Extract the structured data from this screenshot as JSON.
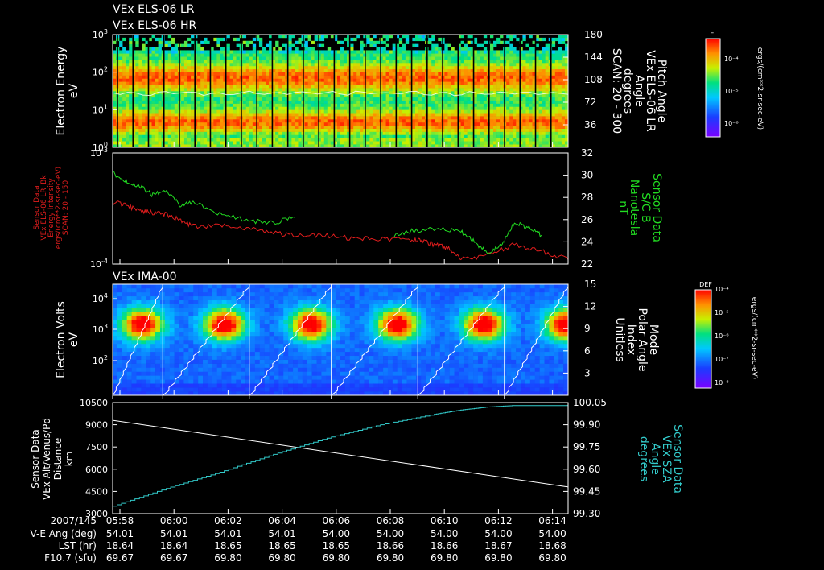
{
  "header": {
    "lines": [
      "VEx ELS-06 LR",
      "VEx ELS-06 HR"
    ]
  },
  "colors": {
    "white": "#ffffff",
    "red": "#e11d1d",
    "green": "#22dd22",
    "cyan": "#33cccc"
  },
  "chart_data": [
    {
      "type": "heatmap",
      "panel": "els-energy",
      "ylabel": [
        "Electron Energy",
        "eV"
      ],
      "y_ticks_left": [
        {
          "mant": "10",
          "exp": "0"
        },
        {
          "mant": "10",
          "exp": "1"
        },
        {
          "mant": "10",
          "exp": "2"
        },
        {
          "mant": "10",
          "exp": "3"
        }
      ],
      "yscale": "log",
      "ylim": [
        1,
        1000
      ],
      "right_axis": {
        "label": [
          "Pitch Angle",
          "VEx ELS-06 LR",
          "Angle",
          "degrees",
          "SCAN: 20 - 300"
        ],
        "ticks": [
          "180",
          "144",
          "108",
          "72",
          "36"
        ],
        "ylim": [
          0,
          180
        ]
      },
      "colorbar": {
        "title": "El",
        "ticks": [
          "10⁻⁴",
          "10⁻⁵",
          "10⁻⁶"
        ],
        "label": "ergs/(cm**2-sr-sec-eV)"
      }
    },
    {
      "type": "line",
      "panel": "sensor-intensity",
      "ylabel": [
        "Sensor Data",
        "VEx ELS-06 LR_Bk",
        "Energy Intensity",
        "ergs/(cm**2-sr-sec-eV)",
        "SCAN: 20 - 150"
      ],
      "y_ticks_left": [
        {
          "mant": "10",
          "exp": "-4"
        },
        {
          "mant": "10",
          "exp": "-3"
        }
      ],
      "yscale": "log",
      "ylim": [
        0.0001,
        0.001
      ],
      "right_axis": {
        "label": [
          "Sensor Data",
          "S/C B",
          "Nanotesla",
          "nT"
        ],
        "ticks": [
          "32",
          "30",
          "28",
          "26",
          "24",
          "22"
        ],
        "ylim": [
          22,
          32
        ]
      },
      "series": [
        {
          "color": "red",
          "axis": "left",
          "x": [
            0,
            0.5,
            1,
            1.5,
            2,
            2.5,
            3,
            4,
            5,
            6,
            7,
            8,
            9,
            10,
            11,
            11.5,
            12,
            12.5,
            13,
            14,
            15,
            16,
            17
          ],
          "values": [
            0.00036,
            0.00034,
            0.0003,
            0.00029,
            0.00028,
            0.00025,
            0.00022,
            0.00022,
            0.00021,
            0.00019,
            0.00018,
            0.00018,
            0.00017,
            0.00017,
            0.000165,
            0.000165,
            0.00015,
            0.00014,
            0.00011,
            0.00012,
            0.00015,
            0.00013,
            0.00011
          ]
        },
        {
          "color": "green",
          "axis": "right",
          "x": [
            0,
            0.5,
            1,
            1.5,
            2,
            2.5,
            3,
            4,
            5,
            6,
            6.8
          ],
          "values": [
            30.2,
            29.5,
            29.0,
            28.2,
            28.6,
            27.3,
            27.6,
            26.5,
            25.9,
            25.7,
            26.2
          ]
        },
        {
          "color": "green",
          "axis": "right",
          "x": [
            10.5,
            11,
            12,
            13,
            13.5,
            14,
            14.5,
            15,
            15.5,
            16
          ],
          "values": [
            24.6,
            24.9,
            25.2,
            24.9,
            24.0,
            23.0,
            23.6,
            25.7,
            25.3,
            24.6
          ]
        }
      ]
    },
    {
      "type": "heatmap",
      "panel": "ima-energy",
      "title": "VEx IMA-00",
      "ylabel": [
        "Electron Volts",
        "eV"
      ],
      "y_ticks_left": [
        {
          "mant": "10",
          "exp": "2"
        },
        {
          "mant": "10",
          "exp": "3"
        },
        {
          "mant": "10",
          "exp": "4"
        }
      ],
      "yscale": "log",
      "right_axis": {
        "label": [
          "Mode",
          "Polar Angle",
          "Index",
          "Unitless"
        ],
        "ticks": [
          "15",
          "12",
          "9",
          "6",
          "3"
        ],
        "ylim": [
          0,
          15
        ]
      },
      "colorbar": {
        "title": "DEF",
        "ticks": [
          "10⁻⁴",
          "10⁻⁵",
          "10⁻⁶",
          "10⁻⁷",
          "10⁻⁸"
        ],
        "label": "ergs/(cm**2-sr-sec-eV)"
      }
    },
    {
      "type": "line",
      "panel": "altitude-sza",
      "ylabel": [
        "Sensor Data",
        "VEx Alt/Venus/Pd",
        "Distance",
        "km"
      ],
      "y_ticks_left": [
        "10500",
        "9000",
        "7500",
        "6000",
        "4500",
        "3000"
      ],
      "ylim": [
        3000,
        10500
      ],
      "right_axis": {
        "label": [
          "Sensor Data",
          "VEx SZA",
          "Angle",
          "degrees"
        ],
        "ticks": [
          "100.05",
          "99.90",
          "99.75",
          "99.60",
          "99.45",
          "99.30"
        ],
        "ylim": [
          99.3,
          100.05
        ]
      },
      "series": [
        {
          "color": "white",
          "axis": "left",
          "x": [
            0,
            17
          ],
          "values": [
            9300,
            4800
          ]
        },
        {
          "color": "cyan",
          "axis": "right",
          "x": [
            0,
            2,
            4,
            6,
            8,
            10,
            12,
            13,
            14,
            15,
            16,
            17
          ],
          "values": [
            99.35,
            99.47,
            99.58,
            99.7,
            99.81,
            99.9,
            99.97,
            100.0,
            100.02,
            100.03,
            100.03,
            100.03
          ]
        }
      ]
    }
  ],
  "time_axis": {
    "date": "2007/145",
    "row_labels": [
      "V-E Ang (deg)",
      "LST (hr)",
      "F10.7 (sfu)"
    ],
    "columns": [
      {
        "time": "05:58",
        "vals": [
          "54.01",
          "18.64",
          "69.67"
        ]
      },
      {
        "time": "06:00",
        "vals": [
          "54.01",
          "18.64",
          "69.67"
        ]
      },
      {
        "time": "06:02",
        "vals": [
          "54.01",
          "18.65",
          "69.80"
        ]
      },
      {
        "time": "06:04",
        "vals": [
          "54.01",
          "18.65",
          "69.80"
        ]
      },
      {
        "time": "06:06",
        "vals": [
          "54.00",
          "18.65",
          "69.80"
        ]
      },
      {
        "time": "06:08",
        "vals": [
          "54.00",
          "18.66",
          "69.80"
        ]
      },
      {
        "time": "06:10",
        "vals": [
          "54.00",
          "18.66",
          "69.80"
        ]
      },
      {
        "time": "06:12",
        "vals": [
          "54.00",
          "18.67",
          "69.80"
        ]
      },
      {
        "time": "06:14",
        "vals": [
          "54.00",
          "18.68",
          "69.80"
        ]
      }
    ]
  }
}
